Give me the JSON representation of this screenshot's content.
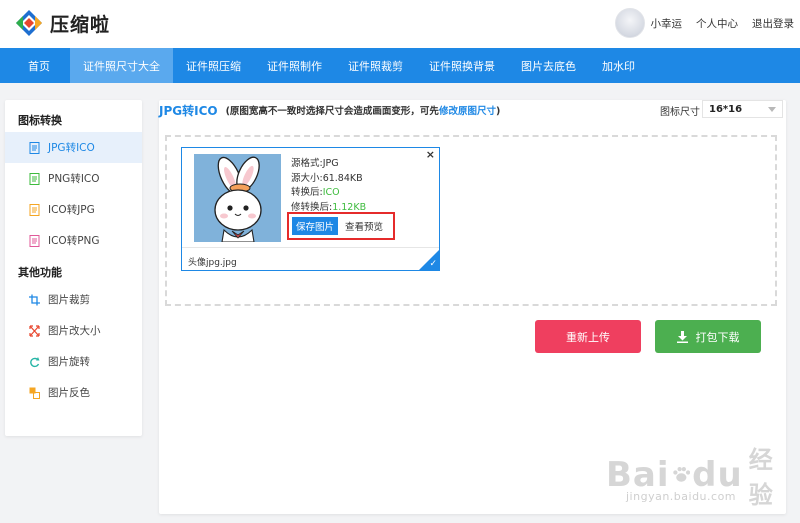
{
  "header": {
    "logo_text": "压缩啦",
    "user_name": "小幸运",
    "links": [
      "个人中心",
      "退出登录"
    ]
  },
  "nav": {
    "items": [
      "首页",
      "证件照尺寸大全",
      "证件照压缩",
      "证件照制作",
      "证件照裁剪",
      "证件照换背景",
      "图片去底色",
      "加水印"
    ],
    "active_index": 1
  },
  "sidebar": {
    "section1_title": "图标转换",
    "section1_items": [
      "JPG转ICO",
      "PNG转ICO",
      "ICO转JPG",
      "ICO转PNG"
    ],
    "section2_title": "其他功能",
    "section2_items": [
      "图片裁剪",
      "图片改大小",
      "图片旋转",
      "图片反色"
    ],
    "active_item": "JPG转ICO"
  },
  "main": {
    "title": "JPG转ICO",
    "note_prefix": "(原图宽高不一致时选择尺寸会造成画面变形，可先",
    "note_link": "修改原图尺寸",
    "note_suffix": ")",
    "size_label": "图标尺寸",
    "size_value": "16*16"
  },
  "file_card": {
    "source_format_label": "源格式:",
    "source_format": "JPG",
    "source_size_label": "源大小:",
    "source_size": "61.84KB",
    "converted_label": "转换后:",
    "converted_format": "ICO",
    "converted_size_label": "修转换后:",
    "converted_size": "1.12KB",
    "save_label": "保存图片",
    "preview_label": "查看预览",
    "file_name": "头像jpg.jpg",
    "close_glyph": "×",
    "check_glyph": "✓"
  },
  "actions": {
    "reupload_label": "重新上传",
    "download_label": "打包下载"
  },
  "watermark": {
    "top_prefix": "Bai",
    "top_suffix": "du",
    "top_cn": "经验",
    "bottom": "jingyan.baidu.com"
  },
  "colors": {
    "nav_bg": "#1e88e5",
    "nav_active": "#5aa9ee",
    "reupload": "#ef3f5f",
    "download": "#4caf50",
    "highlight_box": "#e52b2b"
  }
}
